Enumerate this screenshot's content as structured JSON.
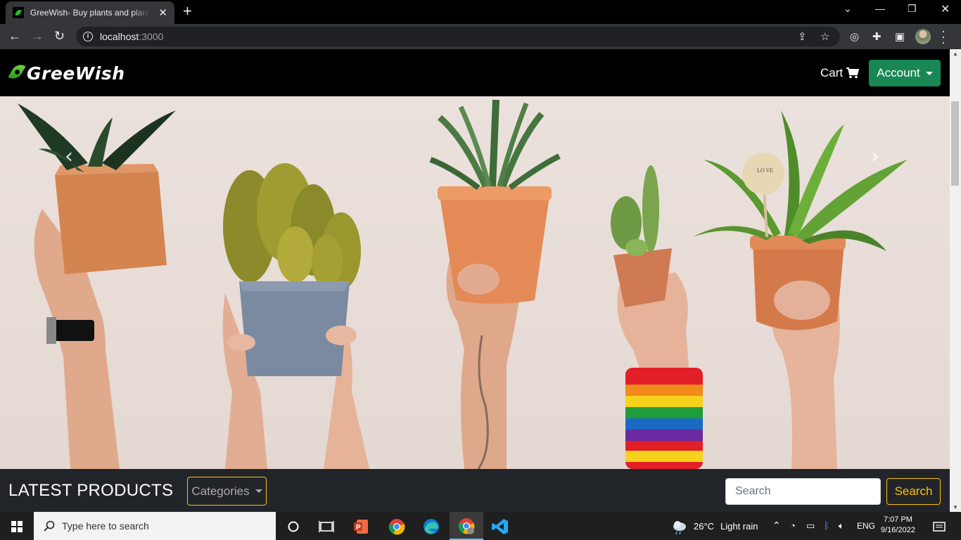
{
  "browser": {
    "tab_title": "GreeWish- Buy plants and plant based products",
    "url_host": "localhost",
    "url_port": ":3000"
  },
  "site": {
    "logo_text": "GreeWish",
    "cart_label": "Cart",
    "account_label": "Account",
    "hero_watermark": "LO VE"
  },
  "products_bar": {
    "title": "LATEST PRODUCTS",
    "categories_label": "Categories",
    "search_placeholder": "Search",
    "search_button": "Search"
  },
  "taskbar": {
    "search_placeholder": "Type here to search",
    "weather_temp": "26°C",
    "weather_desc": "Light rain",
    "language": "ENG",
    "time": "7:07 PM",
    "date": "9/16/2022"
  },
  "colors": {
    "success": "#198754",
    "warning": "#ffc107",
    "dark": "#212529"
  }
}
